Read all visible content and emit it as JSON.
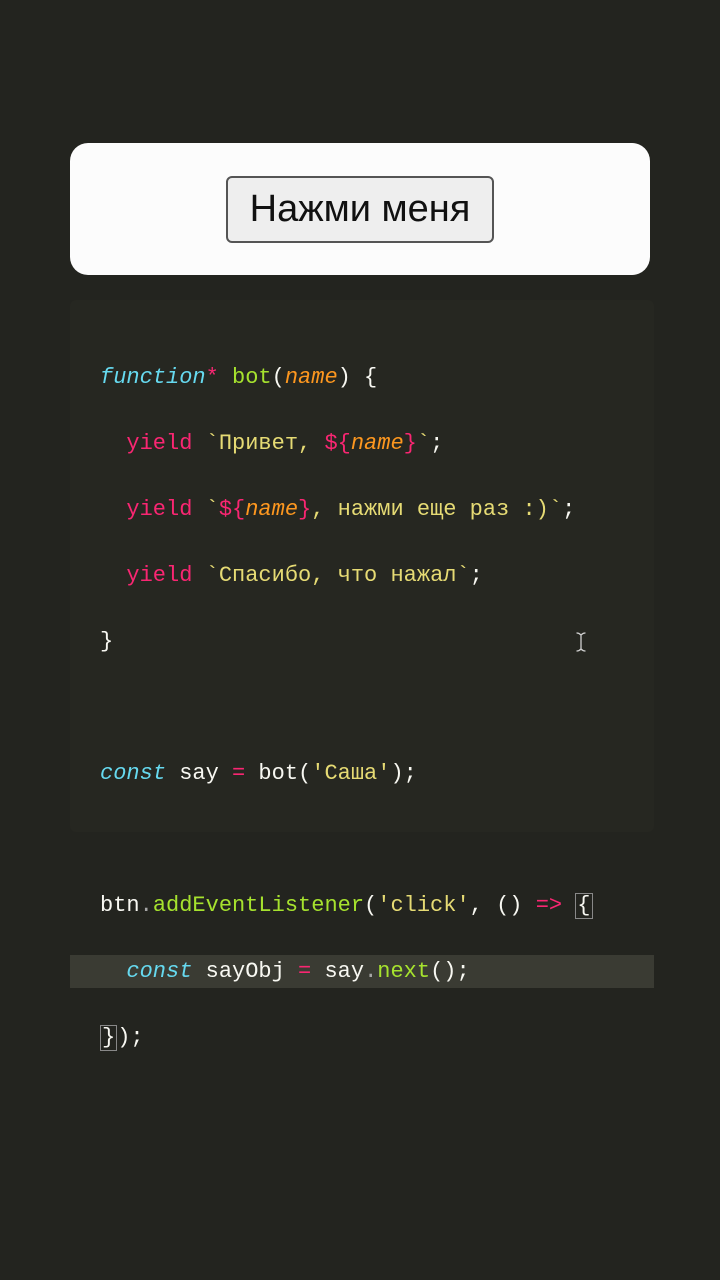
{
  "button": {
    "label": "Нажми меня"
  },
  "code": {
    "l1": {
      "a": "function",
      "star": "*",
      "b": " bot",
      "c": "(",
      "d": "name",
      "e": ") {"
    },
    "l2": {
      "indent": "  ",
      "yield": "yield",
      "sp": " ",
      "bt1": "`",
      "s1": "Привет, ",
      "op": "${",
      "v": "name",
      "cl": "}",
      "bt2": "`",
      "semi": ";"
    },
    "l3": {
      "indent": "  ",
      "yield": "yield",
      "sp": " ",
      "bt1": "`",
      "op": "${",
      "v": "name",
      "cl": "}",
      "s1": ", нажми еще раз :)",
      "bt2": "`",
      "semi": ";"
    },
    "l4": {
      "indent": "  ",
      "yield": "yield",
      "sp": " ",
      "bt1": "`",
      "s1": "Спасибо, что нажал",
      "bt2": "`",
      "semi": ";"
    },
    "l5": {
      "a": "}"
    },
    "l7": {
      "a": "const",
      "b": " say ",
      "eq": "=",
      "c": " bot",
      "d": "(",
      "e": "'Саша'",
      "f": ");"
    },
    "l9": {
      "a": "btn",
      "dot": ".",
      "b": "addEventListener",
      "c": "(",
      "d": "'click'",
      "e": ", ",
      "f": "()",
      "sp": " ",
      "arrow": "=>",
      "sp2": " ",
      "g": "{"
    },
    "l10": {
      "indent": "  ",
      "a": "const",
      "b": " sayObj ",
      "eq": "=",
      "c": " say",
      "dot": ".",
      "d": "next",
      "e": "();"
    },
    "l11": {
      "a": "}",
      "b": ");"
    }
  }
}
